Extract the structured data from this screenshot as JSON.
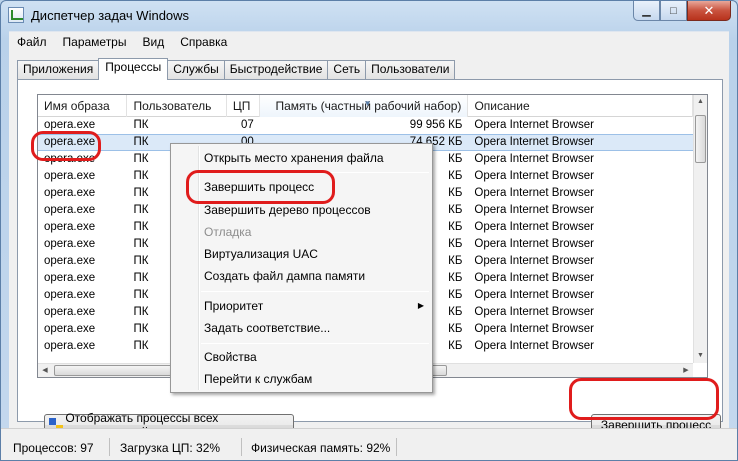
{
  "window": {
    "title": "Диспетчер задач Windows"
  },
  "menu": [
    "Файл",
    "Параметры",
    "Вид",
    "Справка"
  ],
  "tabs": [
    "Приложения",
    "Процессы",
    "Службы",
    "Быстродействие",
    "Сеть",
    "Пользователи"
  ],
  "active_tab": "Процессы",
  "columns": [
    "Имя образа",
    "Пользователь",
    "ЦП",
    "Память (частный рабочий набор)",
    "Описание"
  ],
  "rows": [
    [
      "opera.exe",
      "ПК",
      "07",
      "99 956 КБ",
      "Opera Internet Browser"
    ],
    [
      "opera.exe",
      "ПК",
      "00",
      "74 652 КБ",
      "Opera Internet Browser"
    ],
    [
      "opera.exe",
      "ПК",
      "",
      "КБ",
      "Opera Internet Browser"
    ],
    [
      "opera.exe",
      "ПК",
      "",
      "КБ",
      "Opera Internet Browser"
    ],
    [
      "opera.exe",
      "ПК",
      "",
      "КБ",
      "Opera Internet Browser"
    ],
    [
      "opera.exe",
      "ПК",
      "",
      "КБ",
      "Opera Internet Browser"
    ],
    [
      "opera.exe",
      "ПК",
      "",
      "КБ",
      "Opera Internet Browser"
    ],
    [
      "opera.exe",
      "ПК",
      "",
      "КБ",
      "Opera Internet Browser"
    ],
    [
      "opera.exe",
      "ПК",
      "",
      "КБ",
      "Opera Internet Browser"
    ],
    [
      "opera.exe",
      "ПК",
      "",
      "КБ",
      "Opera Internet Browser"
    ],
    [
      "opera.exe",
      "ПК",
      "",
      "КБ",
      "Opera Internet Browser"
    ],
    [
      "opera.exe",
      "ПК",
      "",
      "КБ",
      "Opera Internet Browser"
    ],
    [
      "opera.exe",
      "ПК",
      "",
      "КБ",
      "Opera Internet Browser"
    ],
    [
      "opera.exe",
      "ПК",
      "",
      "КБ",
      "Opera Internet Browser"
    ]
  ],
  "context_menu": {
    "open_location": "Открыть место хранения файла",
    "end_process": "Завершить процесс",
    "end_tree": "Завершить дерево процессов",
    "debug": "Отладка",
    "uac": "Виртуализация UAC",
    "dump": "Создать файл дампа памяти",
    "priority": "Приоритет",
    "affinity": "Задать соответствие...",
    "properties": "Свойства",
    "goto_services": "Перейти к службам"
  },
  "buttons": {
    "show_all": "Отображать процессы всех пользователей",
    "end_process": "Завершить процесс"
  },
  "status": {
    "processes": "Процессов: 97",
    "cpu": "Загрузка ЦП: 32%",
    "memory": "Физическая память: 92%"
  }
}
